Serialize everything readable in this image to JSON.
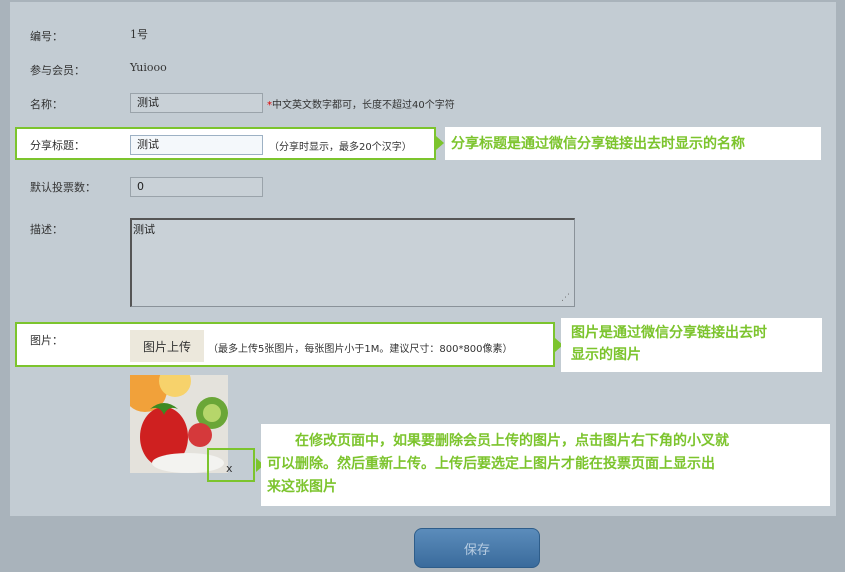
{
  "form": {
    "number_label": "编号：",
    "number_value": "1号",
    "member_label": "参与会员：",
    "member_value": "Yuiooo",
    "name_label": "名称：",
    "name_value": "测试",
    "name_hint_star": "*",
    "name_hint": "中文英文数字都可，长度不超过40个字符",
    "share_title_label": "分享标题：",
    "share_title_value": "测试",
    "share_title_hint": "（分享时显示，最多20个汉字）",
    "default_votes_label": "默认投票数：",
    "default_votes_value": "0",
    "desc_label": "描述：",
    "desc_value": "测试",
    "image_label": "图片：",
    "upload_button": "图片上传",
    "image_hint": "（最多上传5张图片，每张图片小于1M。建议尺寸：800*800像素）",
    "delete_x": "x",
    "save_button": "保存"
  },
  "callouts": {
    "share_title": "分享标题是通过微信分享链接出去时显示的名称",
    "image_line1": "图片是通过微信分享链接出去时",
    "image_line2": "显示的图片",
    "delete_line1": "　　在修改页面中，如果要删除会员上传的图片，点击图片右下角的小叉就",
    "delete_line2": "可以删除。然后重新上传。上传后要选定上图片才能在投票页面上显示出",
    "delete_line3": "来这张图片"
  },
  "colors": {
    "accent": "#7cc42d",
    "panel": "#c3ccd3",
    "save_button": "#4a7bab"
  }
}
